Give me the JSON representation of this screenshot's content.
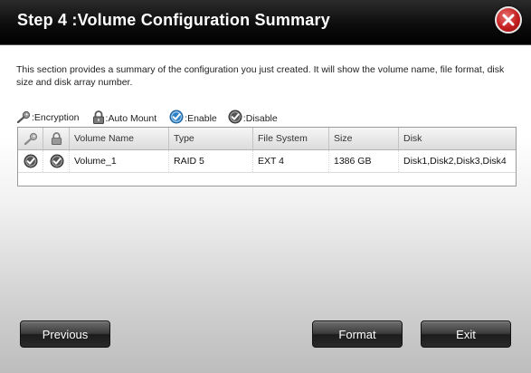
{
  "dialog": {
    "title": "Step 4 :Volume Configuration Summary",
    "description": "This section provides a summary of the configuration you just created. It will show the volume name, file format, disk size and disk array number."
  },
  "legend": {
    "encryption": ":Encryption",
    "auto_mount": ":Auto Mount",
    "enable": ":Enable",
    "disable": ":Disable"
  },
  "table": {
    "columns": [
      "",
      "",
      "Volume Name",
      "Type",
      "File System",
      "Size",
      "Disk"
    ],
    "column_icons": [
      "key-icon",
      "lock-icon"
    ],
    "rows": [
      {
        "encryption": "disable",
        "auto_mount": "disable",
        "volume_name": "Volume_1",
        "type": "RAID 5",
        "file_system": "EXT 4",
        "size": "1386 GB",
        "disk": "Disk1,Disk2,Disk3,Disk4"
      }
    ]
  },
  "buttons": {
    "previous": "Previous",
    "format": "Format",
    "exit": "Exit"
  },
  "colors": {
    "title_bar": "#000000",
    "close_button": "#c41f1f",
    "enable_icon": "#2f82c8",
    "disable_icon": "#555555"
  }
}
